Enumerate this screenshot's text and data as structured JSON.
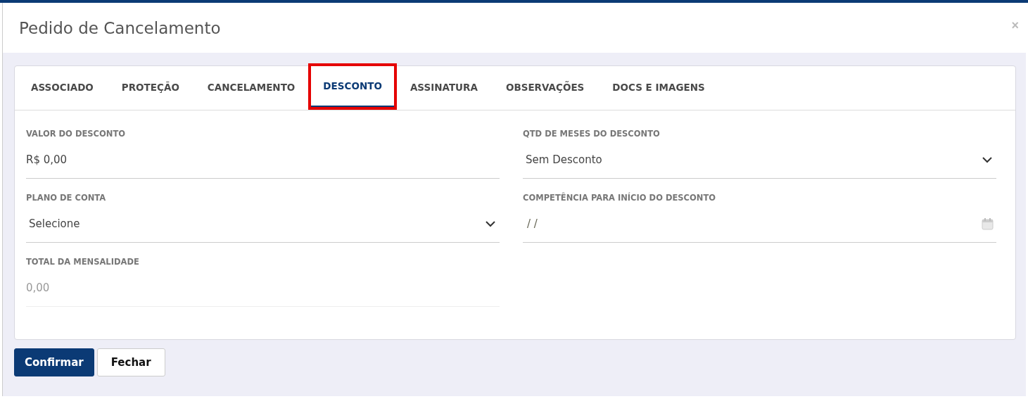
{
  "window": {
    "title": "Pedido de Cancelamento",
    "close": "×"
  },
  "tabs": [
    {
      "label": "ASSOCIADO",
      "selected": false,
      "highlighted": false
    },
    {
      "label": "PROTEÇÃO",
      "selected": false,
      "highlighted": false
    },
    {
      "label": "CANCELAMENTO",
      "selected": false,
      "highlighted": false
    },
    {
      "label": "DESCONTO",
      "selected": true,
      "highlighted": true
    },
    {
      "label": "ASSINATURA",
      "selected": false,
      "highlighted": false
    },
    {
      "label": "OBSERVAÇÕES",
      "selected": false,
      "highlighted": false
    },
    {
      "label": "DOCS E IMAGENS",
      "selected": false,
      "highlighted": false
    }
  ],
  "fields": [
    {
      "kind": "text",
      "label": "VALOR DO DESCONTO",
      "value": "R$ 0,00"
    },
    {
      "kind": "select",
      "label": "QTD DE MESES DO DESCONTO",
      "value": "Sem Desconto"
    },
    {
      "kind": "select",
      "label": "PLANO DE CONTA",
      "value": "Selecione"
    },
    {
      "kind": "date",
      "label": "COMPETÊNCIA PARA INÍCIO DO DESCONTO",
      "value": "/ /"
    },
    {
      "kind": "readonly",
      "label": "TOTAL DA MENSALIDADE",
      "value": "0,00"
    }
  ],
  "buttons": [
    {
      "label": "Confirmar",
      "kind": "primary"
    },
    {
      "label": "Fechar",
      "kind": "secondary"
    }
  ]
}
